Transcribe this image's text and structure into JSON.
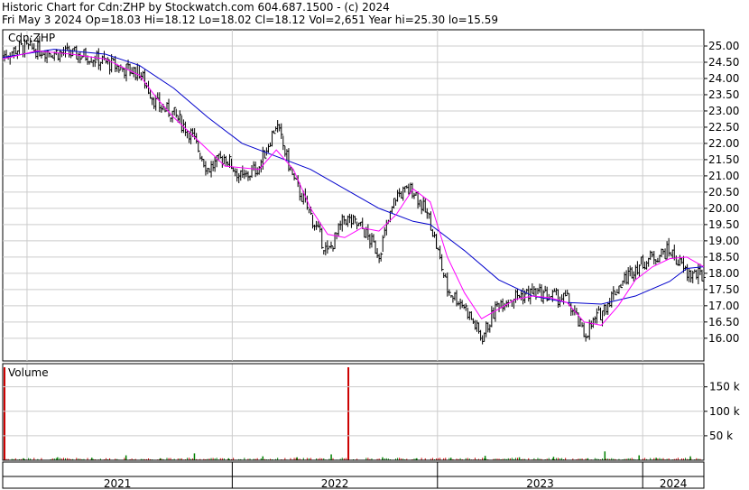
{
  "header": {
    "line1": "Historic Chart for Cdn:ZHP by Stockwatch.com 604.687.1500 - (c) 2024",
    "line2": "Fri May  3 2024  Op=18.03  Hi=18.12  Lo=18.02  Cl=18.12  Vol=2,651  Year hi=25.30  lo=15.59"
  },
  "colors": {
    "up_bar": "#008000",
    "down_bar": "#cc0000",
    "price_bar": "#000000",
    "ma_short": "#ff00ff",
    "ma_long": "#0000cc",
    "grid": "#cccccc",
    "border": "#000000",
    "year_band": "#ffffff"
  },
  "chart_data": {
    "type": "ohlc",
    "title": "Cdn:ZHP",
    "price_axis": {
      "ylim": [
        15.59,
        25.3
      ],
      "ticks": [
        "25.00",
        "24.50",
        "24.00",
        "23.50",
        "23.00",
        "22.50",
        "22.00",
        "21.50",
        "21.00",
        "20.50",
        "20.00",
        "19.50",
        "19.00",
        "18.50",
        "18.00",
        "17.50",
        "17.00",
        "16.50",
        "16.00"
      ],
      "grid": true
    },
    "volume_axis": {
      "label": "Volume",
      "ticks": [
        "150 k",
        "100 k",
        "50 k"
      ],
      "ylim": [
        0,
        190
      ]
    },
    "x_axis": {
      "years": [
        "2021",
        "2022",
        "2023",
        "2024"
      ],
      "range": [
        "2020-12",
        "2024-05"
      ]
    },
    "price_series": {
      "name": "Close",
      "points": [
        [
          "2020-12",
          24.7
        ],
        [
          "2021-01",
          24.95
        ],
        [
          "2021-02",
          24.9
        ],
        [
          "2021-03",
          24.8
        ],
        [
          "2021-04",
          24.75
        ],
        [
          "2021-05",
          24.7
        ],
        [
          "2021-06",
          24.5
        ],
        [
          "2021-07",
          24.3
        ],
        [
          "2021-08",
          24.2
        ],
        [
          "2021-09",
          23.2
        ],
        [
          "2021-10",
          22.9
        ],
        [
          "2021-11",
          22.3
        ],
        [
          "2021-12",
          21.2
        ],
        [
          "2022-01",
          21.6
        ],
        [
          "2022-02",
          20.9
        ],
        [
          "2022-03",
          21.3
        ],
        [
          "2022-04",
          22.6
        ],
        [
          "2022-05",
          20.9
        ],
        [
          "2022-06",
          19.8
        ],
        [
          "2022-07",
          18.6
        ],
        [
          "2022-08",
          19.7
        ],
        [
          "2022-09",
          19.4
        ],
        [
          "2022-10",
          18.6
        ],
        [
          "2022-11",
          20.4
        ],
        [
          "2022-12",
          20.6
        ],
        [
          "2023-01",
          19.6
        ],
        [
          "2023-02",
          17.5
        ],
        [
          "2023-03",
          17.0
        ],
        [
          "2023-04",
          16.0
        ],
        [
          "2023-05",
          17.1
        ],
        [
          "2023-06",
          17.3
        ],
        [
          "2023-07",
          17.4
        ],
        [
          "2023-08",
          17.3
        ],
        [
          "2023-09",
          17.2
        ],
        [
          "2023-10",
          16.1
        ],
        [
          "2023-11",
          16.8
        ],
        [
          "2023-12",
          17.6
        ],
        [
          "2024-01",
          18.2
        ],
        [
          "2024-02",
          18.5
        ],
        [
          "2024-03",
          18.7
        ],
        [
          "2024-04",
          18.0
        ],
        [
          "2024-05",
          17.9
        ]
      ]
    },
    "ma_short": {
      "name": "",
      "points": [
        [
          "2020-12",
          24.6
        ],
        [
          "2021-02",
          24.85
        ],
        [
          "2021-04",
          24.75
        ],
        [
          "2021-06",
          24.6
        ],
        [
          "2021-08",
          24.1
        ],
        [
          "2021-09",
          23.4
        ],
        [
          "2021-10",
          22.8
        ],
        [
          "2021-12",
          21.8
        ],
        [
          "2022-01",
          21.3
        ],
        [
          "2022-03",
          21.2
        ],
        [
          "2022-04",
          21.8
        ],
        [
          "2022-05",
          21.2
        ],
        [
          "2022-06",
          20.0
        ],
        [
          "2022-07",
          19.2
        ],
        [
          "2022-08",
          19.1
        ],
        [
          "2022-09",
          19.4
        ],
        [
          "2022-10",
          19.3
        ],
        [
          "2022-11",
          19.8
        ],
        [
          "2022-12",
          20.6
        ],
        [
          "2023-01",
          20.2
        ],
        [
          "2023-02",
          18.5
        ],
        [
          "2023-03",
          17.4
        ],
        [
          "2023-04",
          16.6
        ],
        [
          "2023-05",
          16.9
        ],
        [
          "2023-06",
          17.2
        ],
        [
          "2023-07",
          17.3
        ],
        [
          "2023-08",
          17.25
        ],
        [
          "2023-09",
          17.1
        ],
        [
          "2023-10",
          16.5
        ],
        [
          "2023-11",
          16.4
        ],
        [
          "2023-12",
          17.0
        ],
        [
          "2024-01",
          17.8
        ],
        [
          "2024-02",
          18.2
        ],
        [
          "2024-03",
          18.45
        ],
        [
          "2024-04",
          18.5
        ],
        [
          "2024-05",
          18.2
        ]
      ]
    },
    "ma_long": {
      "name": "",
      "points": [
        [
          "2020-12",
          24.65
        ],
        [
          "2021-03",
          24.9
        ],
        [
          "2021-06",
          24.75
        ],
        [
          "2021-08",
          24.4
        ],
        [
          "2021-10",
          23.7
        ],
        [
          "2021-12",
          22.8
        ],
        [
          "2022-02",
          22.0
        ],
        [
          "2022-04",
          21.6
        ],
        [
          "2022-06",
          21.2
        ],
        [
          "2022-08",
          20.6
        ],
        [
          "2022-10",
          20.0
        ],
        [
          "2022-12",
          19.6
        ],
        [
          "2023-01",
          19.5
        ],
        [
          "2023-03",
          18.7
        ],
        [
          "2023-05",
          17.8
        ],
        [
          "2023-07",
          17.3
        ],
        [
          "2023-09",
          17.1
        ],
        [
          "2023-11",
          17.05
        ],
        [
          "2024-01",
          17.3
        ],
        [
          "2024-03",
          17.75
        ],
        [
          "2024-04",
          18.15
        ],
        [
          "2024-05",
          18.2
        ]
      ]
    },
    "volume_spikes_k": [
      [
        "2020-12",
        190
      ],
      [
        "2021-01",
        4
      ],
      [
        "2021-03",
        6
      ],
      [
        "2021-05",
        5
      ],
      [
        "2021-07",
        10
      ],
      [
        "2021-09",
        4
      ],
      [
        "2021-11",
        14
      ],
      [
        "2022-01",
        4
      ],
      [
        "2022-03",
        8
      ],
      [
        "2022-05",
        6
      ],
      [
        "2022-07",
        12
      ],
      [
        "2022-08",
        190
      ],
      [
        "2022-10",
        6
      ],
      [
        "2022-12",
        4
      ],
      [
        "2023-02",
        5
      ],
      [
        "2023-04",
        9
      ],
      [
        "2023-06",
        6
      ],
      [
        "2023-08",
        7
      ],
      [
        "2023-10",
        4
      ],
      [
        "2023-11",
        18
      ],
      [
        "2024-01",
        10
      ],
      [
        "2024-02",
        5
      ],
      [
        "2024-04",
        8
      ]
    ]
  }
}
